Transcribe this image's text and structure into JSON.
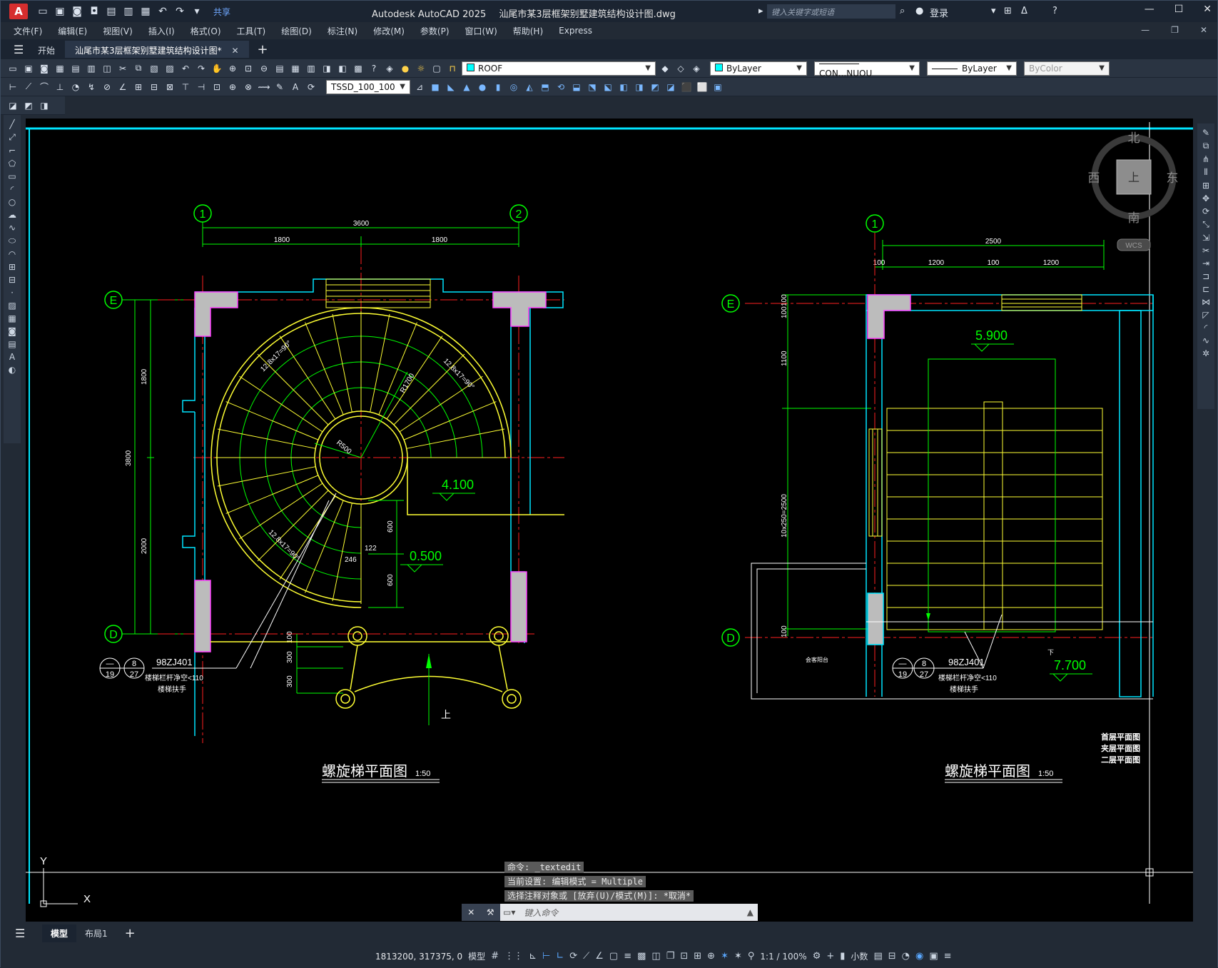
{
  "titlebar": {
    "app_title": "Autodesk AutoCAD 2025",
    "doc_title": "汕尾市某3层框架别墅建筑结构设计图.dwg",
    "share_label": "共享",
    "search_placeholder": "键入关键字或短语",
    "signin_label": "登录",
    "logo_letter": "A"
  },
  "menubar": {
    "items": [
      "文件(F)",
      "编辑(E)",
      "视图(V)",
      "插入(I)",
      "格式(O)",
      "工具(T)",
      "绘图(D)",
      "标注(N)",
      "修改(M)",
      "参数(P)",
      "窗口(W)",
      "帮助(H)",
      "Express"
    ]
  },
  "tabs": {
    "start_label": "开始",
    "drawing_label": "汕尾市某3层框架别墅建筑结构设计图*"
  },
  "toolbar": {
    "layer_value": "ROOF",
    "layer_color": "#00ffff",
    "color_value": "ByLayer",
    "linetype_value": "CON...NUOU",
    "lineweight_value": "ByLayer",
    "plotstyle_value": "ByColor",
    "dimstyle_value": "TSSD_100_100"
  },
  "viewcube": {
    "north": "北",
    "south": "南",
    "east": "东",
    "west": "西",
    "top": "上",
    "wcs": "WCS"
  },
  "drawing": {
    "left": {
      "axis_1": "1",
      "axis_2": "2",
      "axis_e": "E",
      "axis_d": "D",
      "dim_total": "3600",
      "dim_half_a": "1800",
      "dim_half_b": "1800",
      "dim_v_total": "3800",
      "dim_v_top": "1800",
      "dim_v_bottom": "2000",
      "r500": "R500",
      "r1700": "R1700",
      "step_a": "12.8x17=90°",
      "step_b": "12.8x17=90°",
      "step_c": "12.8x17=90°",
      "level_a": "4.100",
      "level_b": "0.500",
      "dim_600a": "600",
      "dim_600b": "600",
      "dim_246": "246",
      "dim_122": "122",
      "dim_100": "100",
      "dim_300a": "300",
      "dim_300b": "300",
      "ref_code": "98ZJ401",
      "ref_top": "—",
      "ref_bot": "19",
      "ref_top2": "8",
      "ref_bot2": "27",
      "note_a": "楼梯栏杆净空<110",
      "note_b": "楼梯扶手",
      "up_label": "上",
      "title": "螺旋梯平面图",
      "scale": "1:50"
    },
    "right": {
      "axis_1": "1",
      "axis_e": "E",
      "axis_d": "D",
      "dim_total": "2500",
      "dim_100a": "100",
      "dim_1200a": "1200",
      "dim_100b": "100",
      "dim_1200b": "1200",
      "dim_v100a": "100",
      "dim_v100b": "100",
      "dim_v1100": "1100",
      "dim_v_steps": "10x250=2500",
      "dim_v100c": "100",
      "level_a": "5.900",
      "level_b": "7.700",
      "ref_code": "98ZJ401",
      "ref_top": "—",
      "ref_bot": "19",
      "ref_top2": "8",
      "ref_bot2": "27",
      "note_a": "楼梯栏杆净空<110",
      "note_b": "楼梯扶手",
      "room_label": "会客阳台",
      "up_label": "下",
      "legend_1": "首层平面图",
      "legend_2": "夹层平面图",
      "legend_3": "二层平面图",
      "title": "螺旋梯平面图",
      "scale": "1:50"
    },
    "ucs_x": "X",
    "ucs_y": "Y"
  },
  "command": {
    "history_1": "命令: _textedit",
    "history_2": "当前设置: 编辑模式 = Multiple",
    "history_3": "选择注释对象或 [放弃(U)/模式(M)]: *取消*",
    "placeholder": "键入命令"
  },
  "layouts": {
    "model": "模型",
    "layout1": "布局1"
  },
  "status": {
    "coords": "1813200, 317375, 0",
    "model_label": "模型",
    "scale": "1:1 / 100%",
    "units": "小数"
  }
}
